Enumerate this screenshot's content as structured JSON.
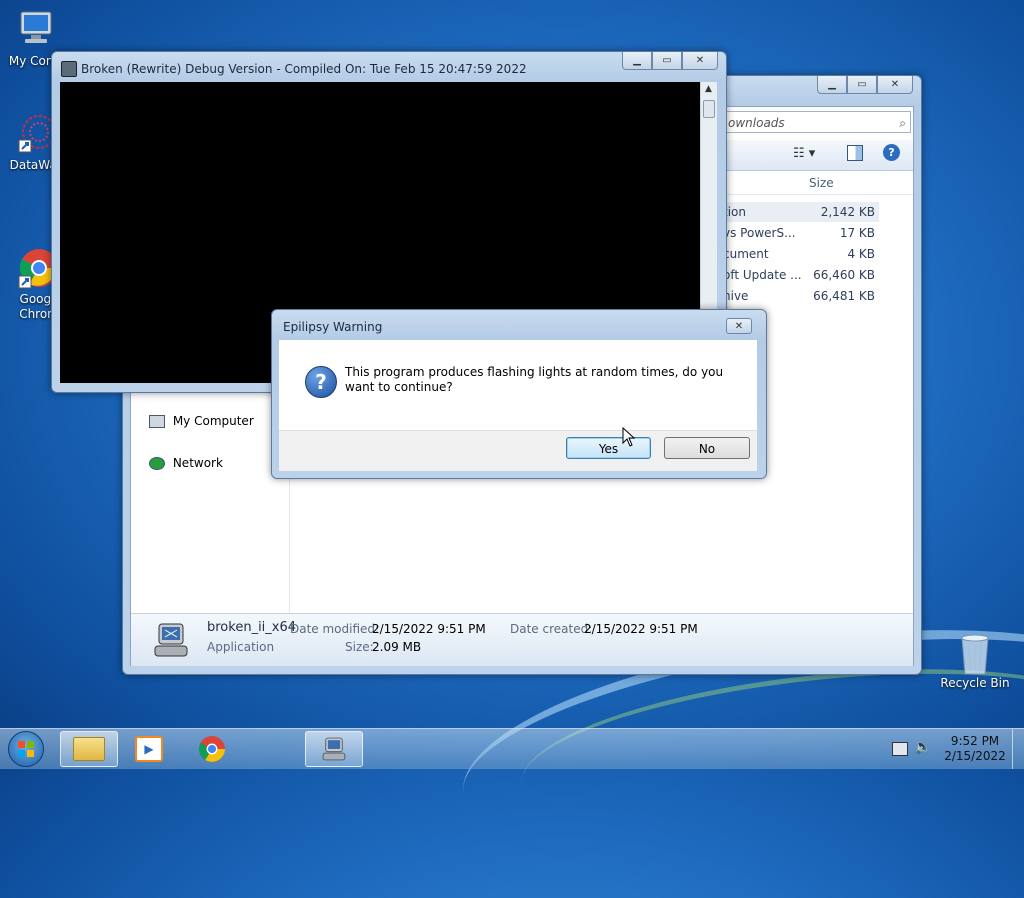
{
  "desktop": {
    "icons": [
      {
        "label": "My Comp",
        "icon": "computer-icon"
      },
      {
        "label": "DataWag",
        "icon": "datawag-shortcut-icon"
      },
      {
        "label": "Googl\nChron",
        "icon": "chrome-icon"
      },
      {
        "label": "Recycle Bin",
        "icon": "recycle-bin-icon"
      }
    ]
  },
  "explorer": {
    "search_placeholder": "ownloads",
    "column_size": "Size",
    "files": [
      {
        "name": "tion",
        "size": "2,142 KB"
      },
      {
        "name": "vs PowerS...",
        "size": "17 KB"
      },
      {
        "name": "cument",
        "size": "4 KB"
      },
      {
        "name": "oft Update ...",
        "size": "66,460 KB"
      },
      {
        "name": "hive",
        "size": "66,481 KB"
      }
    ],
    "nav": [
      {
        "label": "My Computer",
        "icon": "computer-icon"
      },
      {
        "label": "Network",
        "icon": "network-icon"
      }
    ],
    "details": {
      "file_name": "broken_ii_x64",
      "file_type": "Application",
      "date_modified_label": "Date modified:",
      "date_modified": "2/15/2022 9:51 PM",
      "date_created_label": "Date created:",
      "date_created": "2/15/2022 9:51 PM",
      "size_label": "Size:",
      "size": "2.09 MB"
    }
  },
  "console": {
    "title": "Broken (Rewrite) Debug Version - Compiled On: Tue Feb 15 20:47:59 2022"
  },
  "dialog": {
    "title": "Epilipsy Warning",
    "message": "This program produces flashing lights at random times, do you want to continue?",
    "yes": "Yes",
    "no": "No"
  },
  "taskbar": {
    "time": "9:52 PM",
    "date": "2/15/2022"
  },
  "colors": {
    "accent": "#3c7fb1",
    "console_bg": "#000000"
  }
}
